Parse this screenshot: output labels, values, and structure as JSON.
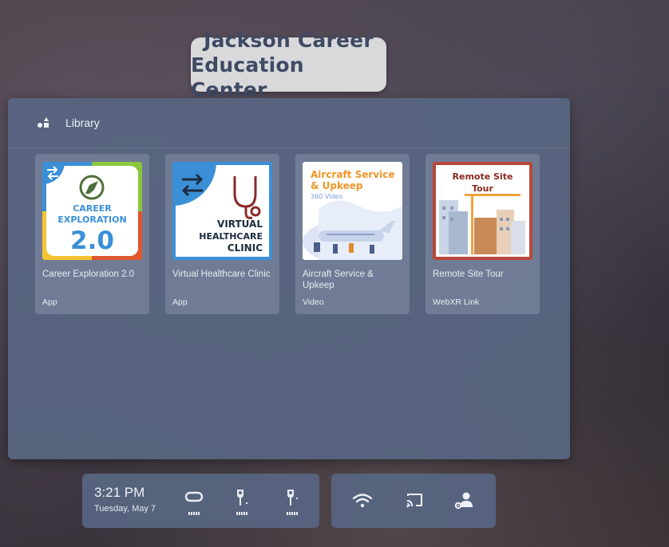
{
  "org": {
    "line1": "Jackson Career",
    "line2": "Education Center"
  },
  "library": {
    "title": "Library",
    "items": [
      {
        "title": "Career Exploration 2.0",
        "type": "App",
        "thumb": {
          "line1": "CAREER",
          "line2": "EXPLORATION",
          "line3": "2.0"
        }
      },
      {
        "title": "Virtual Healthcare Clinic",
        "type": "App",
        "thumb": {
          "line1": "VIRTUAL",
          "line2": "HEALTHCARE",
          "line3": "CLINIC"
        }
      },
      {
        "title": "Aircraft Service & Upkeep",
        "type": "Video",
        "thumb": {
          "line1": "Aircraft Service",
          "line2": "& Upkeep",
          "line3": "360 Video"
        }
      },
      {
        "title": "Remote Site Tour",
        "type": "WebXR Link",
        "thumb": {
          "line1": "Remote Site",
          "line2": "Tour"
        }
      }
    ]
  },
  "dock": {
    "time": "3:21 PM",
    "date": "Tuesday, May 7",
    "devices": [
      "headset-icon",
      "left-controller-icon",
      "right-controller-icon"
    ],
    "quick_actions": [
      "wifi-icon",
      "cast-icon",
      "account-settings-icon"
    ]
  },
  "colors": {
    "panel": "#586682",
    "title_text": "#3f4a63",
    "accent_blue": "#3a8fd6"
  }
}
